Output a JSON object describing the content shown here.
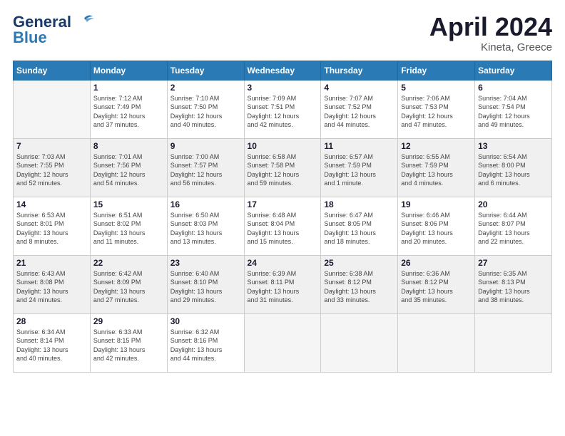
{
  "header": {
    "logo_line1": "General",
    "logo_line2": "Blue",
    "title": "April 2024",
    "subtitle": "Kineta, Greece"
  },
  "weekdays": [
    "Sunday",
    "Monday",
    "Tuesday",
    "Wednesday",
    "Thursday",
    "Friday",
    "Saturday"
  ],
  "weeks": [
    [
      {
        "day": "",
        "info": ""
      },
      {
        "day": "1",
        "info": "Sunrise: 7:12 AM\nSunset: 7:49 PM\nDaylight: 12 hours\nand 37 minutes."
      },
      {
        "day": "2",
        "info": "Sunrise: 7:10 AM\nSunset: 7:50 PM\nDaylight: 12 hours\nand 40 minutes."
      },
      {
        "day": "3",
        "info": "Sunrise: 7:09 AM\nSunset: 7:51 PM\nDaylight: 12 hours\nand 42 minutes."
      },
      {
        "day": "4",
        "info": "Sunrise: 7:07 AM\nSunset: 7:52 PM\nDaylight: 12 hours\nand 44 minutes."
      },
      {
        "day": "5",
        "info": "Sunrise: 7:06 AM\nSunset: 7:53 PM\nDaylight: 12 hours\nand 47 minutes."
      },
      {
        "day": "6",
        "info": "Sunrise: 7:04 AM\nSunset: 7:54 PM\nDaylight: 12 hours\nand 49 minutes."
      }
    ],
    [
      {
        "day": "7",
        "info": "Sunrise: 7:03 AM\nSunset: 7:55 PM\nDaylight: 12 hours\nand 52 minutes."
      },
      {
        "day": "8",
        "info": "Sunrise: 7:01 AM\nSunset: 7:56 PM\nDaylight: 12 hours\nand 54 minutes."
      },
      {
        "day": "9",
        "info": "Sunrise: 7:00 AM\nSunset: 7:57 PM\nDaylight: 12 hours\nand 56 minutes."
      },
      {
        "day": "10",
        "info": "Sunrise: 6:58 AM\nSunset: 7:58 PM\nDaylight: 12 hours\nand 59 minutes."
      },
      {
        "day": "11",
        "info": "Sunrise: 6:57 AM\nSunset: 7:59 PM\nDaylight: 13 hours\nand 1 minute."
      },
      {
        "day": "12",
        "info": "Sunrise: 6:55 AM\nSunset: 7:59 PM\nDaylight: 13 hours\nand 4 minutes."
      },
      {
        "day": "13",
        "info": "Sunrise: 6:54 AM\nSunset: 8:00 PM\nDaylight: 13 hours\nand 6 minutes."
      }
    ],
    [
      {
        "day": "14",
        "info": "Sunrise: 6:53 AM\nSunset: 8:01 PM\nDaylight: 13 hours\nand 8 minutes."
      },
      {
        "day": "15",
        "info": "Sunrise: 6:51 AM\nSunset: 8:02 PM\nDaylight: 13 hours\nand 11 minutes."
      },
      {
        "day": "16",
        "info": "Sunrise: 6:50 AM\nSunset: 8:03 PM\nDaylight: 13 hours\nand 13 minutes."
      },
      {
        "day": "17",
        "info": "Sunrise: 6:48 AM\nSunset: 8:04 PM\nDaylight: 13 hours\nand 15 minutes."
      },
      {
        "day": "18",
        "info": "Sunrise: 6:47 AM\nSunset: 8:05 PM\nDaylight: 13 hours\nand 18 minutes."
      },
      {
        "day": "19",
        "info": "Sunrise: 6:46 AM\nSunset: 8:06 PM\nDaylight: 13 hours\nand 20 minutes."
      },
      {
        "day": "20",
        "info": "Sunrise: 6:44 AM\nSunset: 8:07 PM\nDaylight: 13 hours\nand 22 minutes."
      }
    ],
    [
      {
        "day": "21",
        "info": "Sunrise: 6:43 AM\nSunset: 8:08 PM\nDaylight: 13 hours\nand 24 minutes."
      },
      {
        "day": "22",
        "info": "Sunrise: 6:42 AM\nSunset: 8:09 PM\nDaylight: 13 hours\nand 27 minutes."
      },
      {
        "day": "23",
        "info": "Sunrise: 6:40 AM\nSunset: 8:10 PM\nDaylight: 13 hours\nand 29 minutes."
      },
      {
        "day": "24",
        "info": "Sunrise: 6:39 AM\nSunset: 8:11 PM\nDaylight: 13 hours\nand 31 minutes."
      },
      {
        "day": "25",
        "info": "Sunrise: 6:38 AM\nSunset: 8:12 PM\nDaylight: 13 hours\nand 33 minutes."
      },
      {
        "day": "26",
        "info": "Sunrise: 6:36 AM\nSunset: 8:12 PM\nDaylight: 13 hours\nand 35 minutes."
      },
      {
        "day": "27",
        "info": "Sunrise: 6:35 AM\nSunset: 8:13 PM\nDaylight: 13 hours\nand 38 minutes."
      }
    ],
    [
      {
        "day": "28",
        "info": "Sunrise: 6:34 AM\nSunset: 8:14 PM\nDaylight: 13 hours\nand 40 minutes."
      },
      {
        "day": "29",
        "info": "Sunrise: 6:33 AM\nSunset: 8:15 PM\nDaylight: 13 hours\nand 42 minutes."
      },
      {
        "day": "30",
        "info": "Sunrise: 6:32 AM\nSunset: 8:16 PM\nDaylight: 13 hours\nand 44 minutes."
      },
      {
        "day": "",
        "info": ""
      },
      {
        "day": "",
        "info": ""
      },
      {
        "day": "",
        "info": ""
      },
      {
        "day": "",
        "info": ""
      }
    ]
  ]
}
